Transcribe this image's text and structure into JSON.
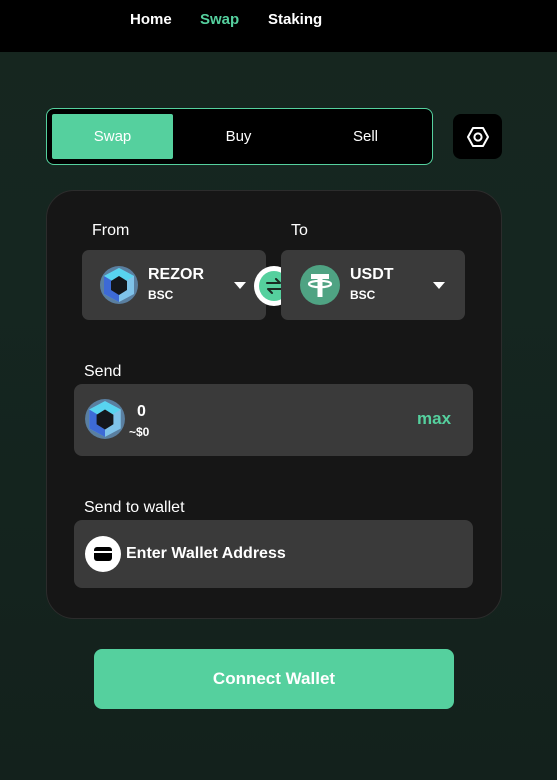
{
  "nav": {
    "home": "Home",
    "swap": "Swap",
    "staking": "Staking"
  },
  "tabs": [
    "Swap",
    "Buy",
    "Sell"
  ],
  "from": {
    "label": "From",
    "token": "REZOR",
    "chain": "BSC"
  },
  "to": {
    "label": "To",
    "token": "USDT",
    "chain": "BSC"
  },
  "send": {
    "label": "Send",
    "amount": "0",
    "usd": "~$0",
    "max": "max"
  },
  "wallet": {
    "label": "Send to wallet",
    "placeholder": "Enter Wallet Address"
  },
  "connect_label": "Connect Wallet",
  "icons": {
    "settings": "settings-hex-icon",
    "swap_direction": "swap-arrows-icon",
    "wallet": "wallet-icon",
    "caret": "caret-down-icon"
  },
  "colors": {
    "accent": "#55d09e",
    "usdt": "#4fa383"
  }
}
